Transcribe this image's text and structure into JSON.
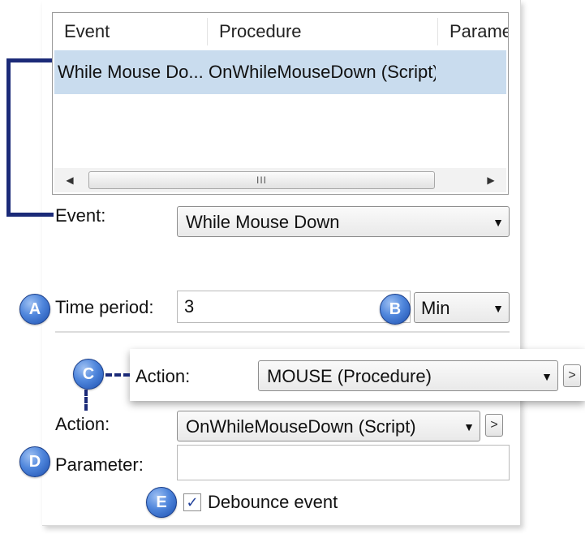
{
  "list": {
    "columns": [
      "Event",
      "Procedure",
      "Parame"
    ],
    "rows": [
      {
        "event": "While Mouse Do...",
        "procedure": "OnWhileMouseDown (Script)",
        "parameter": ""
      }
    ],
    "scroll_left": "◀",
    "scroll_right": "▶",
    "scroll_grip": "III"
  },
  "event": {
    "label": "Event:",
    "value": "While Mouse Down"
  },
  "time_period": {
    "badge": "A",
    "label": "Time period:",
    "value": "3",
    "unit_badge": "B",
    "unit_value": "Min"
  },
  "action_callout": {
    "badge": "C",
    "label": "Action:",
    "value": "MOUSE (Procedure)",
    "more": ">"
  },
  "action": {
    "label": "Action:",
    "value": "OnWhileMouseDown (Script)",
    "more": ">"
  },
  "parameter": {
    "badge": "D",
    "label": "Parameter:",
    "value": ""
  },
  "debounce": {
    "badge": "E",
    "label": "Debounce event",
    "checked": true,
    "check_mark": "✓"
  },
  "icons": {
    "dropdown": "▼"
  },
  "colors": {
    "selection": "#c9dcee",
    "connector": "#1b2a78",
    "badge": "#4f86dc"
  }
}
